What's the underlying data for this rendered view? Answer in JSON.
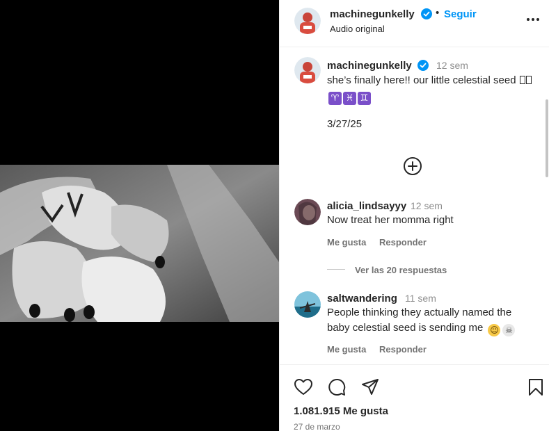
{
  "header": {
    "username": "machinegunkelly",
    "separator": "•",
    "follow_label": "Seguir",
    "audio_label": "Audio original",
    "more_icon": "more-horizontal-icon"
  },
  "caption": {
    "username": "machinegunkelly",
    "time": "12 sem",
    "text": "she’s finally here!! our little celestial seed",
    "zodiac": [
      "♈",
      "♓",
      "♊"
    ],
    "date": "3/27/25"
  },
  "comments": [
    {
      "username": "alicia_lindsayyy",
      "time": "12 sem",
      "text": "Now treat her momma right",
      "like_label": "Me gusta",
      "reply_label": "Responder"
    },
    {
      "username": "saltwandering",
      "time": "11 sem",
      "text": "People thinking they actually named the baby celestial seed is sending me",
      "like_label": "Me gusta",
      "reply_label": "Responder"
    }
  ],
  "replies_toggle": "Ver las 20 respuestas",
  "actions": {
    "likes": "1.081.915 Me gusta",
    "date": "27 de marzo"
  },
  "colors": {
    "link_blue": "#0095f6",
    "verified_blue": "#0095f6",
    "text": "#262626",
    "secondary": "#737373"
  }
}
